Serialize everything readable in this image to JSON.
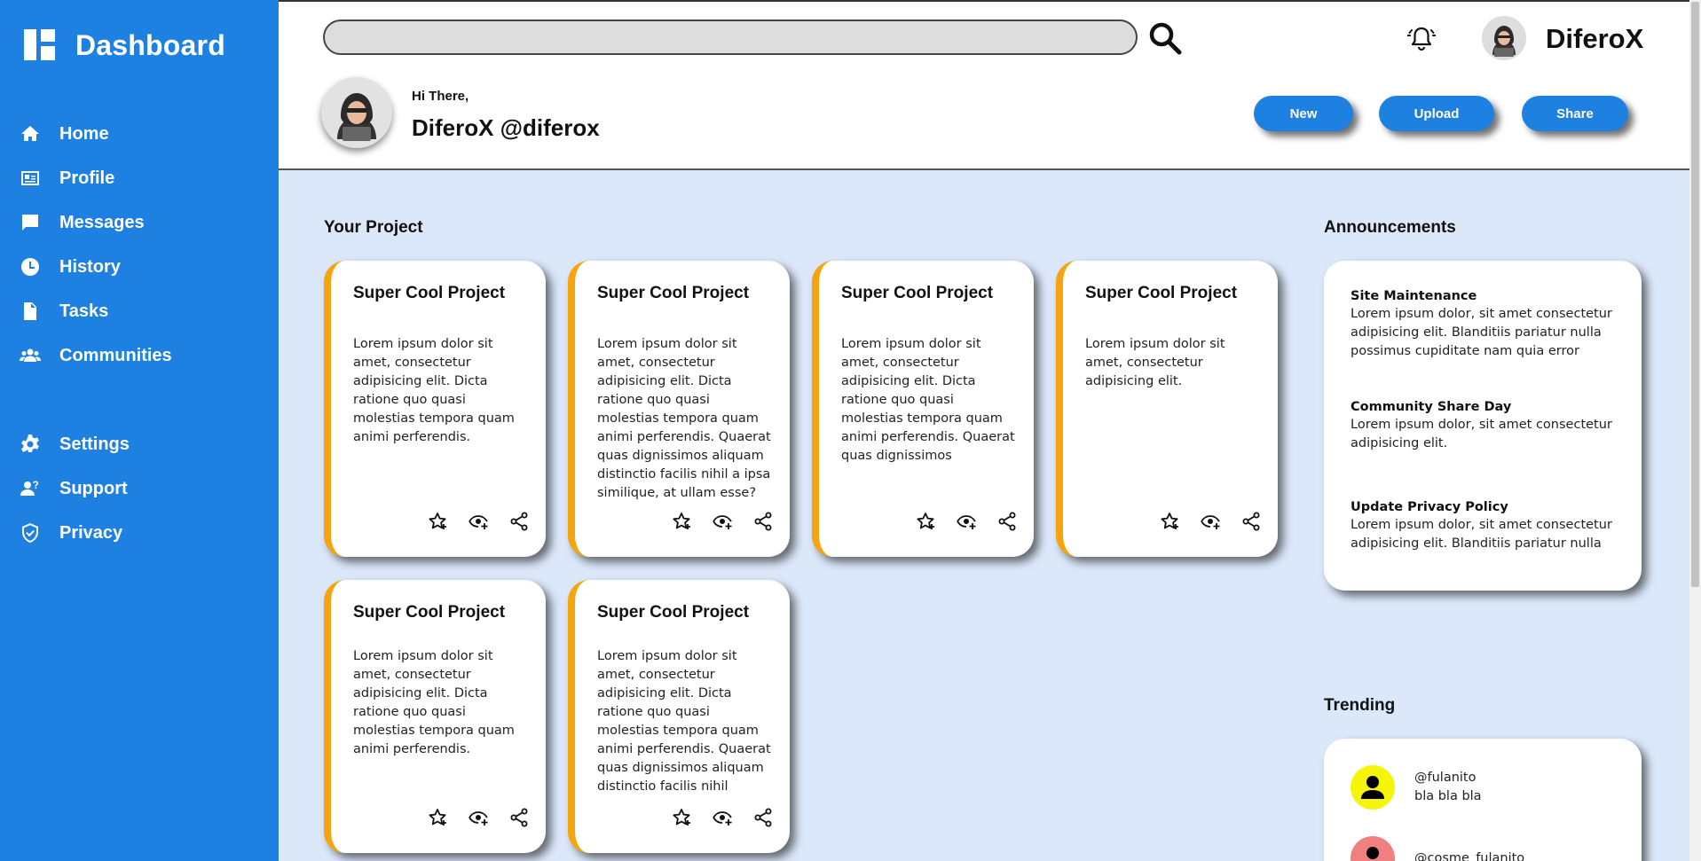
{
  "brand": {
    "title": "Dashboard"
  },
  "sidebar": {
    "items": [
      {
        "label": "Home",
        "icon": "home-icon"
      },
      {
        "label": "Profile",
        "icon": "profile-icon"
      },
      {
        "label": "Messages",
        "icon": "message-icon"
      },
      {
        "label": "History",
        "icon": "clock-icon"
      },
      {
        "label": "Tasks",
        "icon": "document-icon"
      },
      {
        "label": "Communities",
        "icon": "people-icon"
      },
      {
        "label": "Settings",
        "icon": "gear-icon"
      },
      {
        "label": "Support",
        "icon": "support-icon"
      },
      {
        "label": "Privacy",
        "icon": "shield-icon"
      }
    ]
  },
  "header": {
    "search_placeholder": "",
    "username": "DiferoX",
    "greeting": "Hi There,",
    "handle": "DiferoX @diferox",
    "buttons": {
      "new": "New",
      "upload": "Upload",
      "share": "Share"
    }
  },
  "projects": {
    "title": "Your Project",
    "cards": [
      {
        "title": "Super Cool Project",
        "text": "Lorem ipsum dolor sit amet, consectetur adipisicing elit. Dicta ratione quo quasi molestias tempora quam animi perferendis."
      },
      {
        "title": "Super Cool Project",
        "text": "Lorem ipsum dolor sit amet, consectetur adipisicing elit. Dicta ratione quo quasi molestias tempora quam animi perferendis. Quaerat quas dignissimos aliquam distinctio facilis nihil a ipsa similique, at ullam esse?"
      },
      {
        "title": "Super Cool Project",
        "text": "Lorem ipsum dolor sit amet, consectetur adipisicing elit. Dicta ratione quo quasi molestias tempora quam animi perferendis. Quaerat quas dignissimos"
      },
      {
        "title": "Super Cool Project",
        "text": "Lorem ipsum dolor sit amet, consectetur adipisicing elit."
      },
      {
        "title": "Super Cool Project",
        "text": "Lorem ipsum dolor sit amet, consectetur adipisicing elit. Dicta ratione quo quasi molestias tempora quam animi perferendis."
      },
      {
        "title": "Super Cool Project",
        "text": "Lorem ipsum dolor sit amet, consectetur adipisicing elit. Dicta ratione quo quasi molestias tempora quam animi perferendis. Quaerat quas dignissimos aliquam distinctio facilis nihil"
      }
    ]
  },
  "announcements": {
    "title": "Announcements",
    "items": [
      {
        "title": "Site Maintenance",
        "text": "Lorem ipsum dolor, sit amet consectetur adipisicing elit. Blanditiis pariatur nulla possimus cupiditate nam quia error"
      },
      {
        "title": "Community Share Day",
        "text": "Lorem ipsum dolor, sit amet consectetur adipisicing elit."
      },
      {
        "title": "Update Privacy Policy",
        "text": "Lorem ipsum dolor, sit amet consectetur adipisicing elit. Blanditiis pariatur nulla"
      }
    ]
  },
  "trending": {
    "title": "Trending",
    "items": [
      {
        "handle": "@fulanito",
        "text": "bla bla bla",
        "color": "#f5f50a"
      },
      {
        "handle": "@cosme_fulanito",
        "text": "",
        "color": "#f08080"
      }
    ]
  },
  "colors": {
    "primary": "#1e80e0",
    "accent": "#f5a30f",
    "background": "#dbe8fa"
  }
}
